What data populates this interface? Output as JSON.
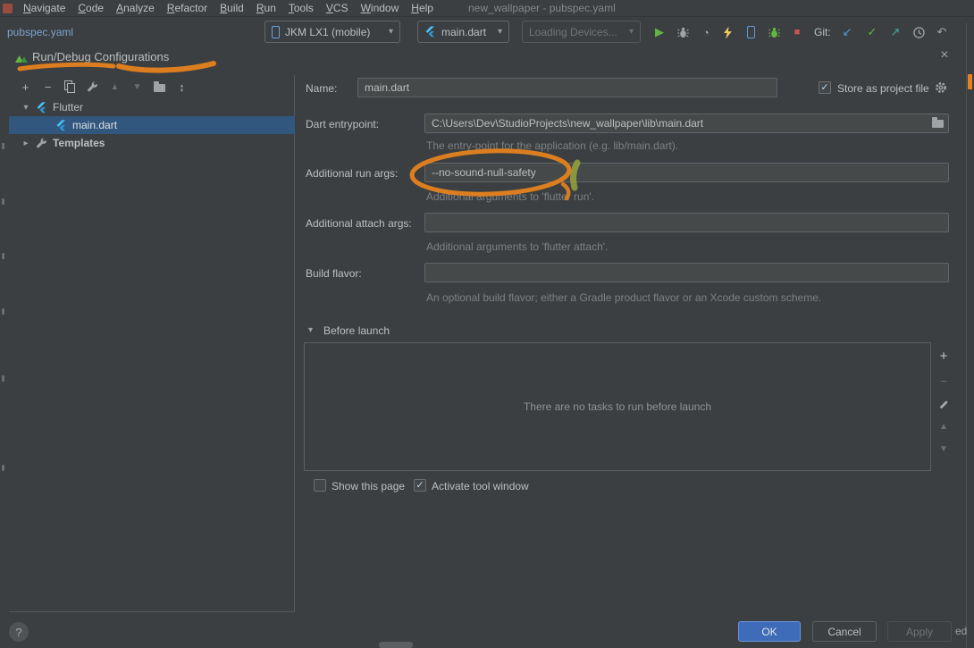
{
  "colors": {
    "annotation_orange": "#e5821e",
    "annotation_green": "#a2b23c",
    "selection_blue": "#31577e",
    "ok_button_blue": "#3e6cb8",
    "flutter_blue": "#47c5fb"
  },
  "icons": {
    "caret_down": "▾",
    "caret_right": "▸",
    "play": "▶",
    "stop_square": "■",
    "check": "✓",
    "git_update": "↙",
    "git_push": "↗",
    "git_rollback": "↶",
    "profile_gauge": "◔",
    "move_up": "▲",
    "move_down": "▼",
    "plus": "+",
    "minus": "−",
    "sort": "↕",
    "close": "×",
    "help": "?"
  },
  "menu": {
    "items": [
      "Navigate",
      "Code",
      "Analyze",
      "Refactor",
      "Build",
      "Run",
      "Tools",
      "VCS",
      "Window",
      "Help"
    ],
    "window_title": "new_wallpaper - pubspec.yaml"
  },
  "toolbar": {
    "breadcrumb": "pubspec.yaml",
    "device_combo": "JKM LX1 (mobile)",
    "config_combo": "main.dart",
    "devices_combo": "Loading Devices...",
    "git_label": "Git:"
  },
  "dialog": {
    "title": "Run/Debug Configurations",
    "tree": {
      "group_flutter": "Flutter",
      "item_main_dart": "main.dart",
      "item_templates": "Templates"
    },
    "form": {
      "name_label": "Name:",
      "name_value": "main.dart",
      "store_label": "Store as project file",
      "entrypoint_label": "Dart entrypoint:",
      "entrypoint_value": "C:\\Users\\Dev\\StudioProjects\\new_wallpaper\\lib\\main.dart",
      "entrypoint_help": "The entry-point for the application (e.g. lib/main.dart).",
      "run_args_label": "Additional run args:",
      "run_args_value": "--no-sound-null-safety",
      "run_args_help": "Additional arguments to 'flutter run'.",
      "attach_args_label": "Additional attach args:",
      "attach_args_value": "",
      "attach_args_help": "Additional arguments to 'flutter attach'.",
      "flavor_label": "Build flavor:",
      "flavor_value": "",
      "flavor_help": "An optional build flavor; either a Gradle product flavor or an Xcode custom scheme.",
      "before_launch_label": "Before launch",
      "before_launch_empty": "There are no tasks to run before launch",
      "show_page_label": "Show this page",
      "activate_label": "Activate tool window"
    },
    "buttons": {
      "ok": "OK",
      "cancel": "Cancel",
      "apply": "Apply"
    }
  },
  "statusbar": {
    "partial_text": "ed"
  }
}
